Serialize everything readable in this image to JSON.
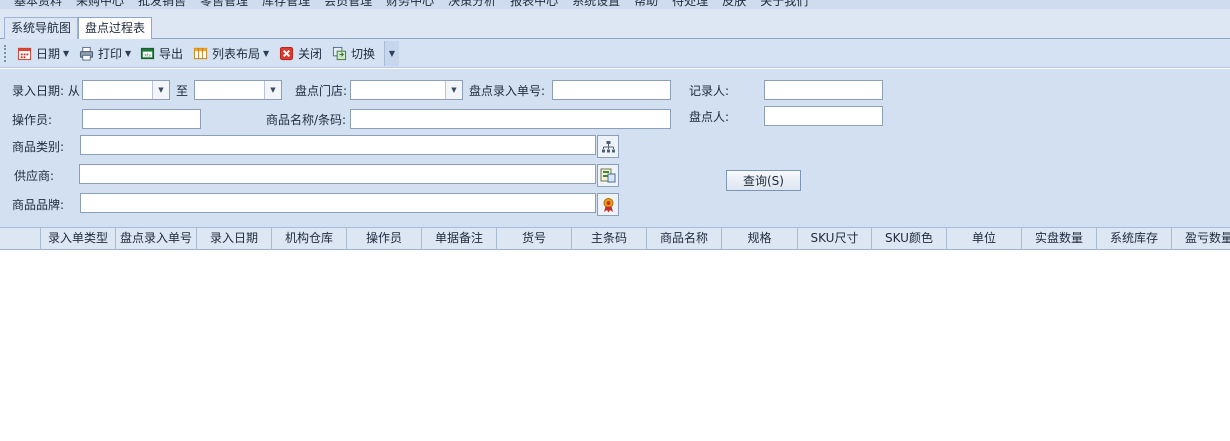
{
  "menu": {
    "items": [
      "基本资料",
      "采购中心",
      "批发销售",
      "零售管理",
      "库存管理",
      "会员管理",
      "财务中心",
      "决策分析",
      "报表中心",
      "系统设置",
      "帮助",
      "待处理",
      "皮肤",
      "关于我们"
    ]
  },
  "tabs": [
    {
      "label": "系统导航图"
    },
    {
      "label": "盘点过程表"
    }
  ],
  "toolbar": {
    "date_label": "日期",
    "print_label": "打印",
    "export_label": "导出",
    "layout_label": "列表布局",
    "close_label": "关闭",
    "switch_label": "切换"
  },
  "filters": {
    "entry_date_label": "录入日期: 从",
    "to_label": "至",
    "store_label": "盘点门店:",
    "entry_no_label": "盘点录入单号:",
    "recorder_label": "记录人:",
    "operator_label": "操作员:",
    "product_label": "商品名称/条码:",
    "counter_label": "盘点人:",
    "category_label": "商品类别:",
    "supplier_label": "供应商:",
    "brand_label": "商品品牌:",
    "query_button": "查询(S)"
  },
  "grid": {
    "columns": [
      "录入单类型",
      "盘点录入单号",
      "录入日期",
      "机构仓库",
      "操作员",
      "单据备注",
      "货号",
      "主条码",
      "商品名称",
      "规格",
      "SKU尺寸",
      "SKU颜色",
      "单位",
      "实盘数量",
      "系统库存",
      "盈亏数量"
    ]
  },
  "colors": {
    "panel_bg": "#d3e0f1",
    "toolbar_bg": "#d5e2f3",
    "border": "#8d9fb8"
  }
}
